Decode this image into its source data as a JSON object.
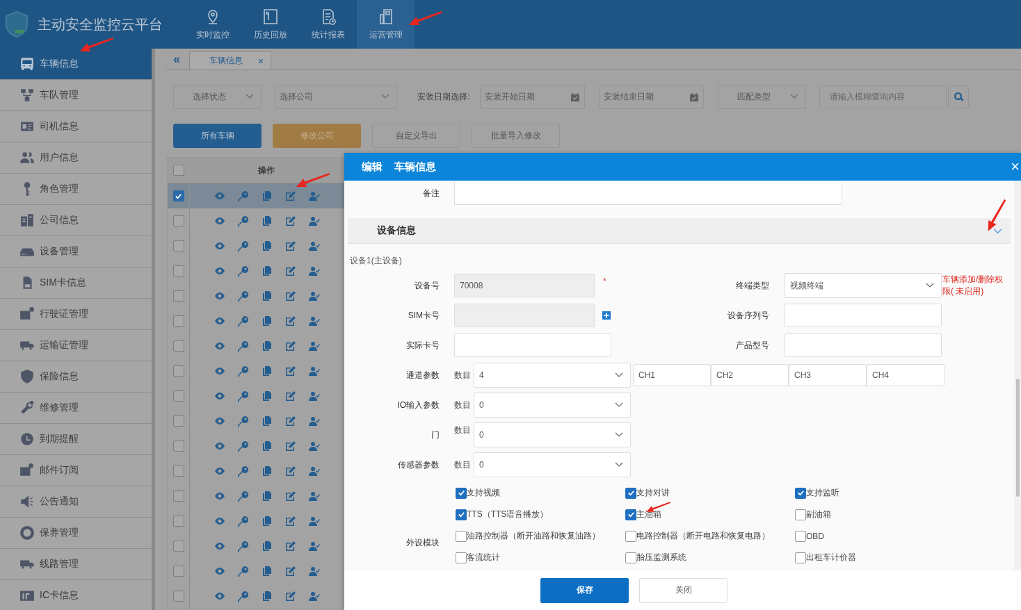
{
  "header": {
    "title": "主动安全监控云平台",
    "nav": [
      {
        "label": "实时监控",
        "selected": false,
        "kind": "pin"
      },
      {
        "label": "历史回放",
        "selected": false,
        "kind": "panel"
      },
      {
        "label": "统计报表",
        "selected": false,
        "kind": "report"
      },
      {
        "label": "运营管理",
        "selected": true,
        "kind": "office"
      }
    ]
  },
  "sidebar": {
    "items": [
      {
        "label": "车辆信息",
        "selected": true,
        "kind": "bus"
      },
      {
        "label": "车队管理",
        "selected": false,
        "kind": "network"
      },
      {
        "label": "司机信息",
        "selected": false,
        "kind": "idcard"
      },
      {
        "label": "用户信息",
        "selected": false,
        "kind": "users"
      },
      {
        "label": "角色管理",
        "selected": false,
        "kind": "key"
      },
      {
        "label": "公司信息",
        "selected": false,
        "kind": "building"
      },
      {
        "label": "设备管理",
        "selected": false,
        "kind": "device"
      },
      {
        "label": "SIM卡信息",
        "selected": false,
        "kind": "sim"
      },
      {
        "label": "行驶证管理",
        "selected": false,
        "kind": "cardgear"
      },
      {
        "label": "运输证管理",
        "selected": false,
        "kind": "truck"
      },
      {
        "label": "保险信息",
        "selected": false,
        "kind": "shield"
      },
      {
        "label": "维修管理",
        "selected": false,
        "kind": "wrench"
      },
      {
        "label": "到期提醒",
        "selected": false,
        "kind": "clock"
      },
      {
        "label": "邮件订阅",
        "selected": false,
        "kind": "mail"
      },
      {
        "label": "公告通知",
        "selected": false,
        "kind": "speaker"
      },
      {
        "label": "保养管理",
        "selected": false,
        "kind": "lifebuoy"
      },
      {
        "label": "线路管理",
        "selected": false,
        "kind": "truck"
      },
      {
        "label": "IC卡信息",
        "selected": false,
        "kind": "card"
      }
    ]
  },
  "tabbar": {
    "collapse": "«",
    "tabs": [
      {
        "label": "车辆信息",
        "selected": true,
        "close": "×"
      }
    ]
  },
  "filters": {
    "status_select": "选择状态",
    "company_select": "选择公司",
    "date_label": "安装日期选择:",
    "start_date_placeholder": "安装开始日期",
    "end_date_placeholder": "安装结束日期",
    "match_select": "匹配类型",
    "search_placeholder": "请输入模糊查询内容"
  },
  "actions": [
    {
      "label": "所有车辆",
      "kind": "primary"
    },
    {
      "label": "修改公司",
      "kind": "warning"
    },
    {
      "label": "自定义导出",
      "kind": "default"
    },
    {
      "label": "批量导入修改",
      "kind": "default"
    }
  ],
  "table": {
    "header_checked": false,
    "columns": [
      "操作"
    ],
    "rows": [
      {
        "selected": true
      },
      {
        "selected": false
      },
      {
        "selected": false
      },
      {
        "selected": false
      },
      {
        "selected": false
      },
      {
        "selected": false
      },
      {
        "selected": false
      },
      {
        "selected": false
      },
      {
        "selected": false
      },
      {
        "selected": false
      },
      {
        "selected": false
      },
      {
        "selected": false
      },
      {
        "selected": false
      },
      {
        "selected": false
      },
      {
        "selected": false
      },
      {
        "selected": false
      },
      {
        "selected": false
      }
    ]
  },
  "dialog": {
    "action": "编辑",
    "title": "车辆信息",
    "close": "×",
    "remark": {
      "label": "备注"
    },
    "section": {
      "title": "设备信息",
      "expanded": true
    },
    "device": {
      "title": "设备1(主设备)",
      "rows": [
        {
          "left": {
            "label": "设备号",
            "value": "70008",
            "disabled": true,
            "addable": false,
            "mark": "*"
          },
          "right": {
            "label": "终端类型",
            "kind": "select",
            "value": "视频终端"
          },
          "note": "车辆添加/删除权限( 未启用)"
        },
        {
          "left": {
            "label": "SIM卡号",
            "disabled": true,
            "addable": true
          },
          "right": {
            "label": "设备序列号",
            "kind": "input"
          }
        },
        {
          "left": {
            "label": "实际卡号",
            "disabled": false,
            "addable": false
          },
          "right": {
            "label": "产品型号",
            "kind": "input"
          }
        }
      ]
    },
    "params": [
      {
        "label": "通道参数",
        "count_label": "数目",
        "value": "4",
        "channels": [
          "CH1",
          "CH2",
          "CH3",
          "CH4"
        ]
      },
      {
        "label": "IO输入参数",
        "count_label": "数目",
        "value": "0"
      },
      {
        "label": "门",
        "count_label": "数目",
        "value": "0"
      },
      {
        "label": "传感器参数",
        "count_label": "数目",
        "value": "0"
      }
    ],
    "peripherals": {
      "label": "外设模块",
      "options": [
        {
          "label": "支持视频",
          "checked": true
        },
        {
          "label": "支持对讲",
          "checked": true
        },
        {
          "label": "支持监听",
          "checked": true
        },
        {
          "label": "TTS（TTS语音播放）",
          "checked": true
        },
        {
          "label": "主油箱",
          "checked": true
        },
        {
          "label": "副油箱",
          "checked": false
        },
        {
          "label": "油路控制器（断开油路和恢复油路）",
          "checked": false
        },
        {
          "label": "电路控制器（断开电路和恢复电路）",
          "checked": false
        },
        {
          "label": "OBD",
          "checked": false
        },
        {
          "label": "客流统计",
          "checked": false
        },
        {
          "label": "胎压监测系统",
          "checked": false
        },
        {
          "label": "出租车计价器",
          "checked": false
        }
      ]
    },
    "buttons": [
      {
        "label": "保存",
        "kind": "primary"
      },
      {
        "label": "关闭",
        "kind": "default"
      }
    ]
  }
}
